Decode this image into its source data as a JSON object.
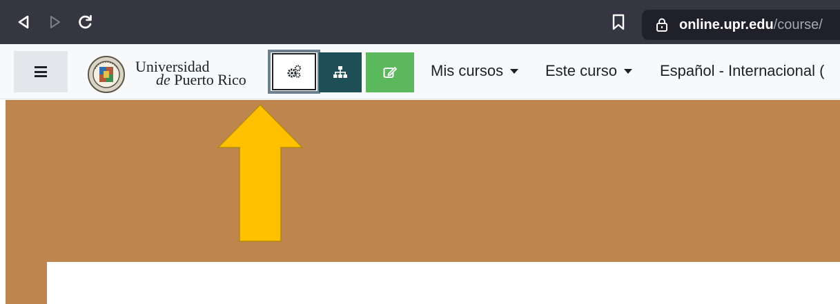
{
  "browser": {
    "url_domain": "online.upr.edu",
    "url_path": "/course/",
    "back_icon": "back-triangle-icon",
    "forward_icon": "forward-triangle-icon",
    "reload_icon": "reload-icon",
    "bookmark_icon": "bookmark-icon",
    "lock_icon": "lock-icon",
    "colors": {
      "chrome": "#353642",
      "url_field": "#1f2029"
    }
  },
  "navbar": {
    "logo_line1": "Universidad",
    "logo_line2_italic": "de",
    "logo_line2_rest": " Puerto Rico",
    "buttons": [
      {
        "name": "settings-gears-button",
        "icon": "gears-icon"
      },
      {
        "name": "sitemap-button",
        "icon": "sitemap-icon"
      },
      {
        "name": "edit-mode-button",
        "icon": "edit-icon"
      }
    ],
    "menus": [
      {
        "label": "Mis cursos"
      },
      {
        "label": "Este curso"
      },
      {
        "label": "Español - Internacional ("
      }
    ],
    "colors": {
      "sitemap_btn": "#1e4e56",
      "edit_btn": "#5cb85c",
      "banner": "#bf854f",
      "arrow": "#ffc000"
    }
  }
}
